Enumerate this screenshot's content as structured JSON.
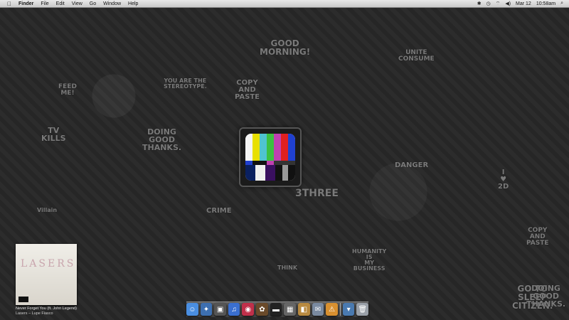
{
  "menubar": {
    "apple_icon": "apple-icon",
    "app_name": "Finder",
    "menus": [
      "File",
      "Edit",
      "View",
      "Go",
      "Window",
      "Help"
    ],
    "status_icons": [
      "bluetooth-icon",
      "time-machine-icon",
      "wifi-icon",
      "volume-icon"
    ],
    "date": "Mar 12",
    "time": "10:58am",
    "spotlight_icon": "spotlight-icon"
  },
  "wallpaper": {
    "texts": [
      "GOOD\nMORNING!",
      "COPY\nAND\nPASTE",
      "YOU ARE THE\nSTEREOTYPE.",
      "FEED\nME!",
      "DOING\nGOOD\nTHANKS.",
      "TV\nKILLS",
      "UNITE\nCONSUME",
      "GO TO\nSLEEP\nCITIZEN.",
      "CRIME",
      "3THREE",
      "DANGER",
      "I ♥\n2D",
      "HUMANITY\nIS\nMY BUSINESS",
      "THINK",
      "Villain",
      "COPY\nAND\nPASTE",
      "DOING\nGOOD\nTHANKS."
    ]
  },
  "desktop_icon": {
    "name": "tv-test-pattern-icon"
  },
  "now_playing": {
    "album_text": "LASERS",
    "title": "Never Forget You (ft. John Legend)",
    "artist": "Lasers – Lupe Fiasco"
  },
  "dock": {
    "items": [
      {
        "name": "finder-icon",
        "color": "#4a8ee0",
        "glyph": "☺"
      },
      {
        "name": "safari-icon",
        "color": "#3d6fb0",
        "glyph": "✦"
      },
      {
        "name": "facetime-icon",
        "color": "#555555",
        "glyph": "▣"
      },
      {
        "name": "itunes-icon",
        "color": "#3a6fd0",
        "glyph": "♫"
      },
      {
        "name": "photo-booth-icon",
        "color": "#c0304a",
        "glyph": "◉"
      },
      {
        "name": "photos-icon",
        "color": "#6a4a2a",
        "glyph": "✿"
      },
      {
        "name": "terminal-icon",
        "color": "#222222",
        "glyph": "▬"
      },
      {
        "name": "activity-monitor-icon",
        "color": "#666666",
        "glyph": "▦"
      },
      {
        "name": "preview-icon",
        "color": "#b88a40",
        "glyph": "◧"
      },
      {
        "name": "mail-icon",
        "color": "#7a8aa0",
        "glyph": "✉"
      },
      {
        "name": "app-store-icon",
        "color": "#d89030",
        "glyph": "⚠"
      },
      {
        "name": "downloads-icon",
        "color": "#4a7ab0",
        "glyph": "▾"
      },
      {
        "name": "trash-icon",
        "color": "#9aa0a8",
        "glyph": "🗑"
      }
    ]
  }
}
